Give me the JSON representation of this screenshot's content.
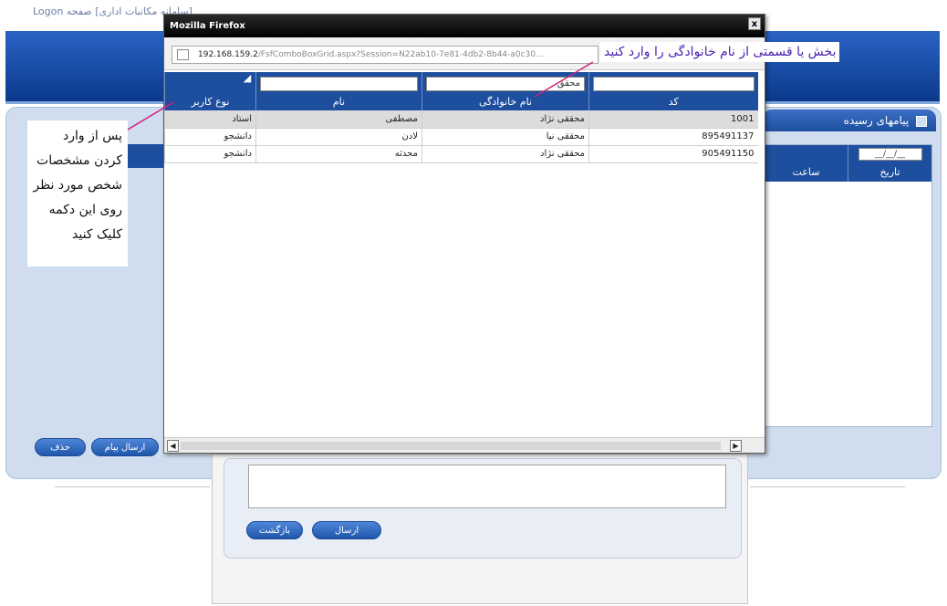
{
  "app": {
    "title": "[سامانه مکاتبات اداری] صفحه Logon"
  },
  "popup": {
    "title": "Mozilla Firefox",
    "close_label": "x",
    "url_host": "192.168.159.2",
    "url_rest": "/FsfComboBoxGrid.aspx?Session=N22ab10-7e81-4db2-8b44-a0c30..."
  },
  "grid": {
    "columns": [
      {
        "header": "کد",
        "filter_value": ""
      },
      {
        "header": "نام خانوادگی",
        "filter_value": "محقق"
      },
      {
        "header": "نام",
        "filter_value": ""
      },
      {
        "header": "نوع کاربر",
        "filter_value": ""
      }
    ],
    "rows": [
      {
        "code": "1001",
        "family": "محققی نژاد",
        "name": "مصطفی",
        "type": "استاد"
      },
      {
        "code": "895491137",
        "family": "محققی نیا",
        "name": "لادن",
        "type": "دانشجو"
      },
      {
        "code": "905491150",
        "family": "محققی نژاد",
        "name": "محدثه",
        "type": "دانشجو"
      }
    ]
  },
  "background": {
    "panel_title": "پیامهای رسیده",
    "date_filter": "__/__/__",
    "inbox_headers": [
      "تاریخ",
      "ساعت"
    ],
    "buttons": {
      "send_message": "ارسال پیام",
      "delete": "حذف",
      "send": "ارسال",
      "back": "بازگشت"
    }
  },
  "annotations": {
    "family_hint": "بخش یا قسمتی از نام خانوادگی را وارد کنید",
    "select_hint": "پس از وارد کردن مشخصات شخص مورد نظر روی این دکمه کلیک کنید"
  },
  "colors": {
    "header_blue": "#1d4f9e",
    "annotation_purple": "#4b1fb0",
    "arrow_magenta": "#d0207a"
  }
}
